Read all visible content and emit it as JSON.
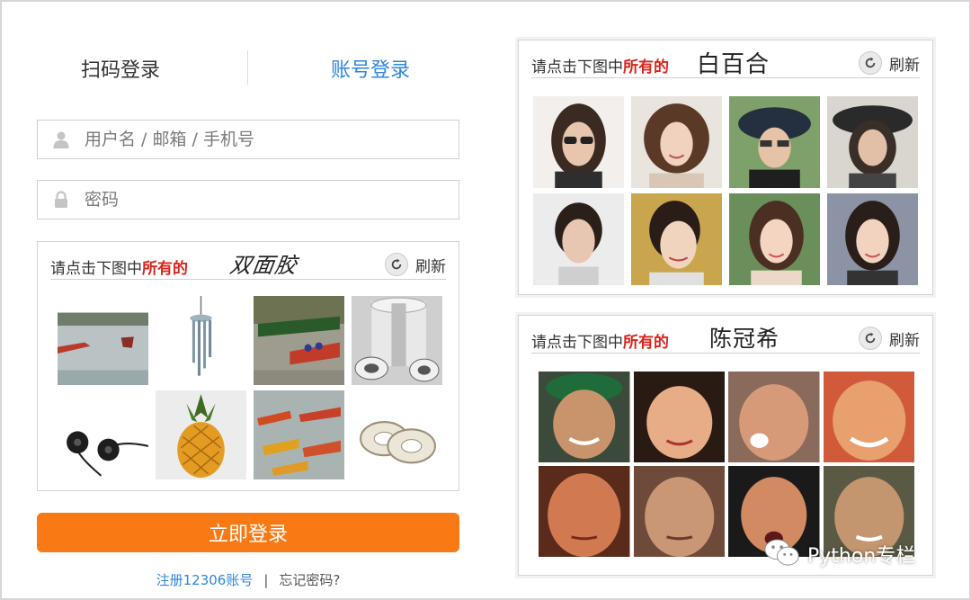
{
  "tabs": {
    "qr_login": "扫码登录",
    "account_login": "账号登录"
  },
  "fields": {
    "username_placeholder": "用户名 / 邮箱 / 手机号",
    "password_placeholder": "密码"
  },
  "captcha_left": {
    "prompt_prefix": "请点击下图中",
    "prompt_highlight": "所有的",
    "target": "双面胶",
    "refresh_label": "刷新",
    "tiles": [
      "boats-on-river",
      "wind-chime",
      "dragon-boat-race",
      "tape-rolls-stack",
      "earphones",
      "pineapple",
      "dragon-boats",
      "double-sided-tape"
    ]
  },
  "captcha_top_right": {
    "prompt_prefix": "请点击下图中",
    "prompt_highlight": "所有的",
    "target": "白百合",
    "refresh_label": "刷新",
    "tiles": [
      "portrait-1",
      "portrait-2",
      "portrait-3",
      "portrait-4",
      "portrait-5",
      "portrait-6",
      "portrait-7",
      "portrait-8"
    ]
  },
  "captcha_bottom_right": {
    "prompt_prefix": "请点击下图中",
    "prompt_highlight": "所有的",
    "target": "陈冠希",
    "refresh_label": "刷新",
    "tiles": [
      "face-1",
      "face-2",
      "face-3",
      "face-4",
      "face-5",
      "face-6",
      "face-7",
      "face-8"
    ]
  },
  "login_button": "立即登录",
  "links": {
    "register": "注册12306账号",
    "separator": "|",
    "forgot": "忘记密码?"
  },
  "watermark": "Python专栏",
  "colors": {
    "accent": "#2f86e0",
    "button": "#f97a14",
    "highlight": "#d9251c"
  },
  "icons": {
    "user": "user-icon",
    "lock": "lock-icon",
    "refresh": "refresh-icon",
    "wechat": "wechat-icon"
  }
}
